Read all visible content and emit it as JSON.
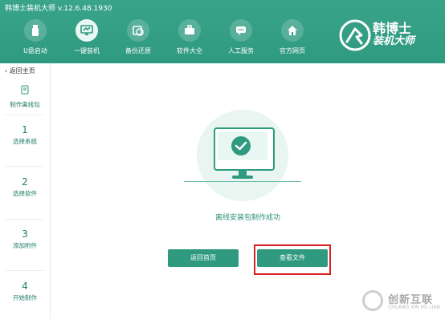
{
  "app": {
    "title": "韩博士装机大师 v.12.6.48.1930"
  },
  "nav": {
    "items": [
      {
        "label": "U盘启动",
        "icon": "usb-drive-icon",
        "active": false
      },
      {
        "label": "一键装机",
        "icon": "monitor-install-icon",
        "active": true
      },
      {
        "label": "备份还原",
        "icon": "backup-restore-icon",
        "active": false
      },
      {
        "label": "软件大全",
        "icon": "software-briefcase-icon",
        "active": false
      },
      {
        "label": "人工服务",
        "icon": "chat-service-icon",
        "active": false
      },
      {
        "label": "官方网页",
        "icon": "home-website-icon",
        "active": false
      }
    ]
  },
  "brand": {
    "line1": "韩博士",
    "line2": "装机大师"
  },
  "sidebar": {
    "back_label": "返回主页",
    "steps": [
      {
        "num": "",
        "label": "制作离线包",
        "icon": "package-icon"
      },
      {
        "num": "1",
        "label": "选择系统"
      },
      {
        "num": "2",
        "label": "选择软件"
      },
      {
        "num": "3",
        "label": "添加附件"
      },
      {
        "num": "4",
        "label": "开始制作"
      }
    ]
  },
  "main": {
    "success_text": "离线安装包制作成功",
    "home_button": "返回首页",
    "view_button": "查看文件"
  },
  "watermark": {
    "cn": "创新互联",
    "en": "CHUANG XIN HU LIAN"
  },
  "colors": {
    "header": "#2f9a80",
    "accent": "#2f9a80",
    "highlight_border": "#d72121"
  }
}
